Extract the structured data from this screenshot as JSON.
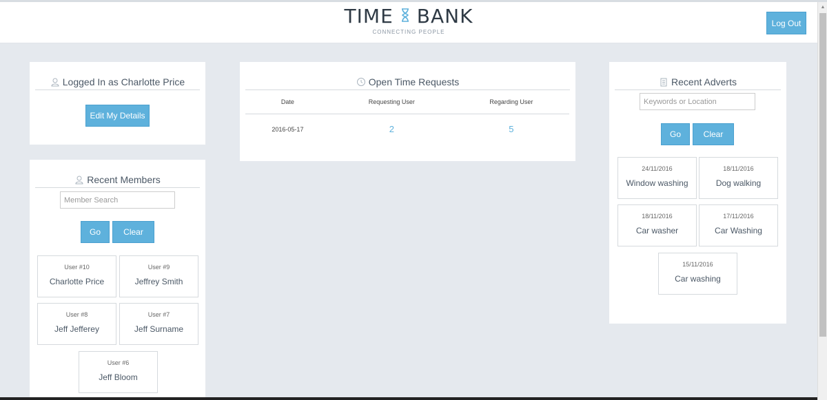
{
  "header": {
    "logo_left": "TIME",
    "logo_right": "BANK",
    "tagline": "CONNECTING PEOPLE",
    "logout_label": "Log Out"
  },
  "user_panel": {
    "title": "Logged In as Charlotte Price",
    "edit_label": "Edit My Details"
  },
  "members_panel": {
    "title": "Recent Members",
    "search_placeholder": "Member Search",
    "go_label": "Go",
    "clear_label": "Clear",
    "members": [
      {
        "id": "User #10",
        "name": "Charlotte Price"
      },
      {
        "id": "User #9",
        "name": "Jeffrey Smith"
      },
      {
        "id": "User #8",
        "name": "Jeff Jefferey"
      },
      {
        "id": "User #7",
        "name": "Jeff Surname"
      },
      {
        "id": "User #6",
        "name": "Jeff Bloom"
      }
    ]
  },
  "requests_panel": {
    "title": "Open Time Requests",
    "columns": [
      "Date",
      "Requesting User",
      "Regarding User"
    ],
    "rows": [
      {
        "date": "2016-05-17",
        "requesting": "2",
        "regarding": "5"
      }
    ]
  },
  "adverts_panel": {
    "title": "Recent Adverts",
    "search_placeholder": "Keywords or Location",
    "go_label": "Go",
    "clear_label": "Clear",
    "adverts": [
      {
        "date": "24/11/2016",
        "title": "Window washing"
      },
      {
        "date": "18/11/2016",
        "title": "Dog walking"
      },
      {
        "date": "18/11/2016",
        "title": "Car washer"
      },
      {
        "date": "17/11/2016",
        "title": "Car Washing"
      },
      {
        "date": "15/11/2016",
        "title": "Car washing"
      }
    ]
  },
  "icons": {
    "user": "user-icon",
    "clock": "clock-icon",
    "document": "document-icon",
    "logo": "hourglass-icon"
  },
  "colors": {
    "accent": "#5eb1dc",
    "background": "#e5e9ee",
    "text": "#4b5866"
  }
}
